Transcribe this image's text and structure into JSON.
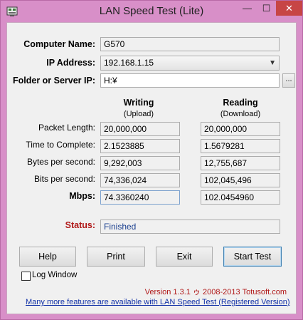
{
  "window": {
    "title": "LAN Speed Test (Lite)",
    "controls": {
      "minimize": "—",
      "maximize": "☐",
      "close": "✕"
    }
  },
  "form": {
    "computer_name_label": "Computer Name:",
    "computer_name": "G570",
    "ip_label": "IP Address:",
    "ip_value": "192.168.1.15",
    "folder_label": "Folder or Server IP:",
    "folder_value": "H:¥",
    "browse_label": "..."
  },
  "results": {
    "writing_header": "Writing",
    "writing_sub": "(Upload)",
    "reading_header": "Reading",
    "reading_sub": "(Download)",
    "rows": [
      {
        "label": "Packet Length:",
        "writing": "20,000,000",
        "reading": "20,000,000"
      },
      {
        "label": "Time to Complete:",
        "writing": "2.1523885",
        "reading": "1.5679281"
      },
      {
        "label": "Bytes per second:",
        "writing": "9,292,003",
        "reading": "12,755,687"
      },
      {
        "label": "Bits per second:",
        "writing": "74,336,024",
        "reading": "102,045,496"
      },
      {
        "label": "Mbps:",
        "writing": "74.3360240",
        "reading": "102.0454960"
      }
    ]
  },
  "status": {
    "label": "Status:",
    "value": "Finished"
  },
  "buttons": {
    "help": "Help",
    "print": "Print",
    "exit": "Exit",
    "start": "Start Test"
  },
  "log_window_label": "Log Window",
  "footer": {
    "version": "Version 1.3.1 ゥ 2008-2013 Totusoft.com",
    "link": "Many more features are available with LAN Speed Test (Registered Version)"
  },
  "colors": {
    "titlebar": "#d88fc8",
    "close": "#c74545",
    "status_label": "#b01818",
    "link": "#1433a8"
  }
}
